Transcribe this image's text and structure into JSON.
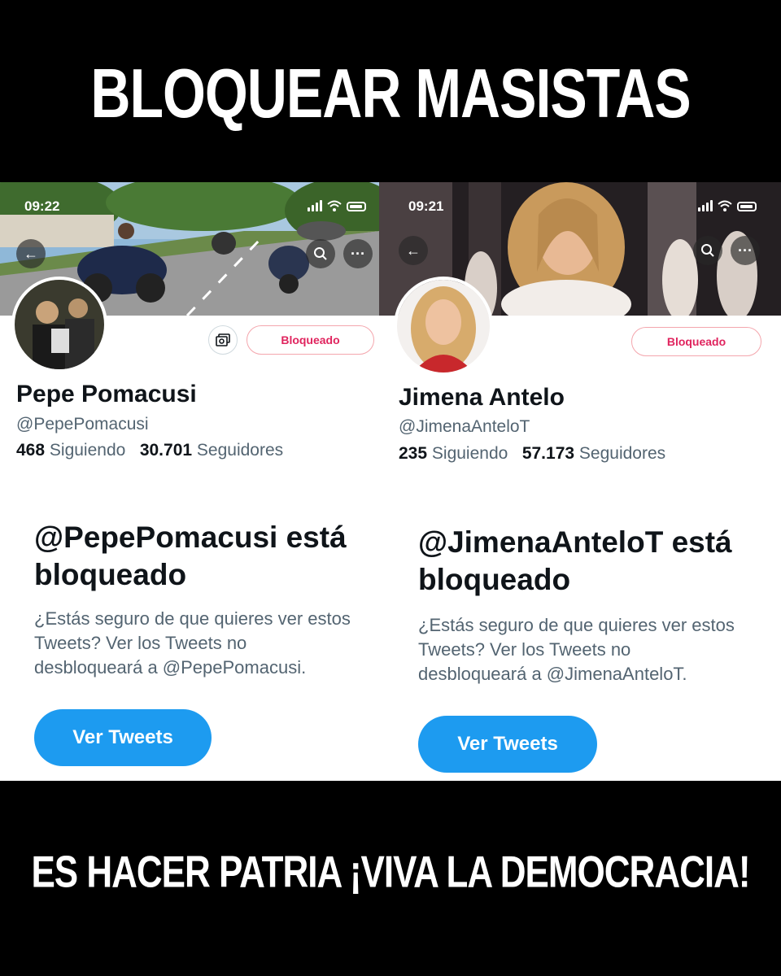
{
  "header": {
    "title": "BLOQUEAR MASISTAS"
  },
  "footer": {
    "slogan": "ES HACER PATRIA ¡VIVA LA DEMOCRACIA!"
  },
  "profiles": [
    {
      "time": "09:22",
      "name": "Pepe Pomacusi",
      "handle": "@PepePomacusi",
      "following_count": "468",
      "following_label": "Siguiendo",
      "followers_count": "30.701",
      "followers_label": "Seguidores",
      "blocked_label": "Bloqueado",
      "blocked_title": "@PepePomacusi está bloqueado",
      "blocked_desc": "¿Estás seguro de que quieres ver estos Tweets? Ver los Tweets no desbloqueará a @PepePomacusi.",
      "view_button": "Ver Tweets"
    },
    {
      "time": "09:21",
      "name": "Jimena Antelo",
      "handle": "@JimenaAnteloT",
      "following_count": "235",
      "following_label": "Siguiendo",
      "followers_count": "57.173",
      "followers_label": "Seguidores",
      "blocked_label": "Bloqueado",
      "blocked_title": "@JimenaAnteloT está bloqueado",
      "blocked_desc": "¿Estás seguro de que quieres ver estos Tweets? Ver los Tweets no desbloqueará a @JimenaAnteloT.",
      "view_button": "Ver Tweets"
    }
  ],
  "icons": {
    "back": "back-arrow-icon",
    "search": "search-icon",
    "more": "more-icon",
    "camera": "camera-icon",
    "signal": "signal-icon",
    "wifi": "wifi-icon",
    "battery": "battery-icon"
  },
  "colors": {
    "background": "#000000",
    "accent_blue": "#1d9bf0",
    "blocked_red": "#e0245e",
    "secondary_text": "#536471"
  }
}
